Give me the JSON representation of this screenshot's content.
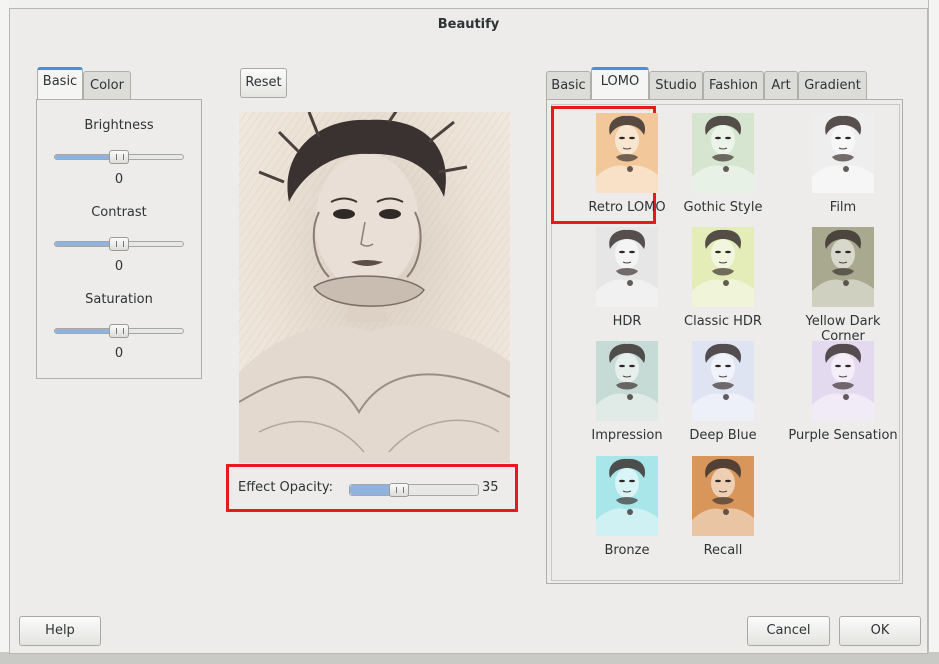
{
  "dialog": {
    "title": "Beautify"
  },
  "left_tabs": [
    "Basic",
    "Color"
  ],
  "adjustments": [
    {
      "label": "Brightness",
      "value": "0"
    },
    {
      "label": "Contrast",
      "value": "0"
    },
    {
      "label": "Saturation",
      "value": "0"
    }
  ],
  "preview": {
    "reset_label": "Reset",
    "opacity_label": "Effect Opacity:",
    "opacity_value": "35"
  },
  "right_tabs": [
    "Basic",
    "LOMO",
    "Studio",
    "Fashion",
    "Art",
    "Gradient"
  ],
  "effects": [
    {
      "label": "Retro LOMO",
      "tint": "#f2c89a"
    },
    {
      "label": "Gothic Style",
      "tint": "#d5e5cf"
    },
    {
      "label": "Film",
      "tint": "#eeeeee"
    },
    {
      "label": "HDR",
      "tint": "#e6e6e6"
    },
    {
      "label": "Classic HDR",
      "tint": "#e4ecb8"
    },
    {
      "label": "Yellow Dark Corner",
      "tint": "#a9a98f"
    },
    {
      "label": "Impression",
      "tint": "#c7dbd6"
    },
    {
      "label": "Deep Blue",
      "tint": "#dfe4f3"
    },
    {
      "label": "Purple Sensation",
      "tint": "#e4daf0"
    },
    {
      "label": "Bronze",
      "tint": "#a8e6ea"
    },
    {
      "label": "Recall",
      "tint": "#d9965a"
    }
  ],
  "footer": {
    "help_label": "Help",
    "cancel_label": "Cancel",
    "ok_label": "OK"
  }
}
